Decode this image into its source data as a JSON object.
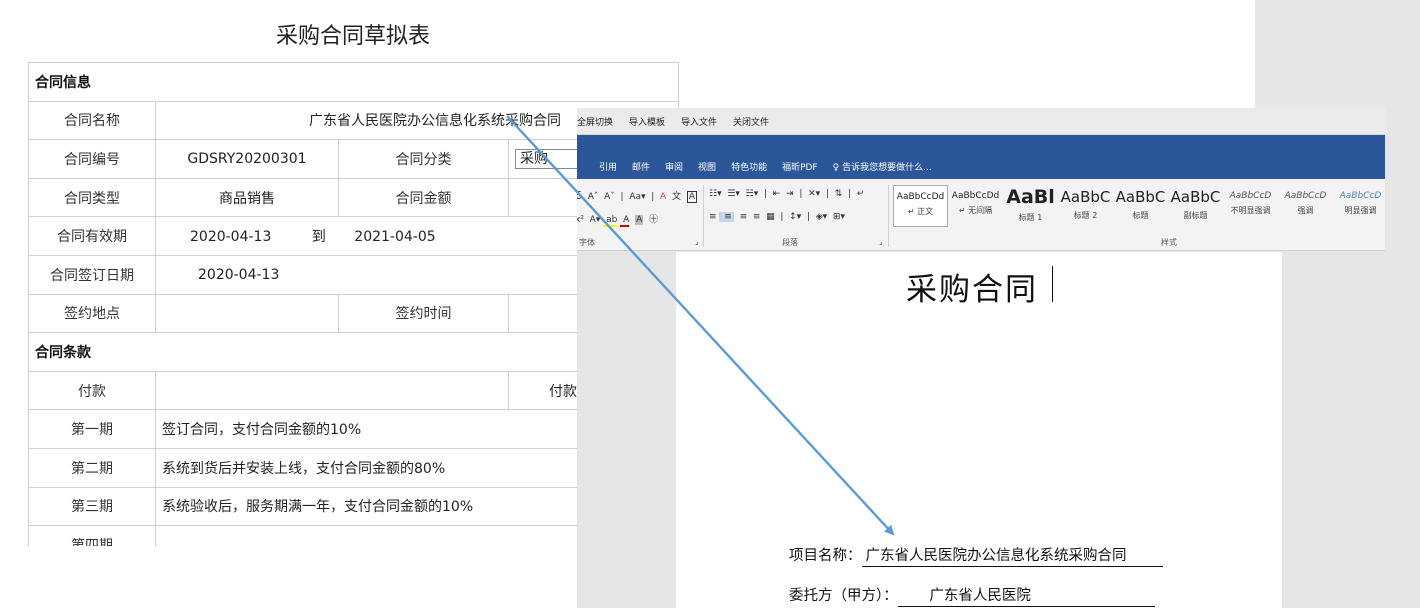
{
  "form": {
    "title": "采购合同草拟表",
    "section_info": "合同信息",
    "name_label": "合同名称",
    "name_value": "广东省人民医院办公信息化系统采购合同",
    "code_label": "合同编号",
    "code_value": "GDSRY20200301",
    "category_label": "合同分类",
    "category_value": "采购",
    "type_label": "合同类型",
    "type_value": "商品销售",
    "amount_label": "合同金额",
    "validity_label": "合同有效期",
    "validity_from": "2020-04-13",
    "validity_to_word": "到",
    "validity_to": "2021-04-05",
    "sign_date_label": "合同签订日期",
    "sign_date_value": "2020-04-13",
    "sign_place_label": "签约地点",
    "sign_time_label": "签约时间",
    "section_terms": "合同条款",
    "payment_label": "付款",
    "payment_col2": "付款",
    "terms": [
      {
        "period": "第一期",
        "text": "签订合同，支付合同金额的10%"
      },
      {
        "period": "第二期",
        "text": "系统到货后并安装上线，支付合同金额的80%"
      },
      {
        "period": "第三期",
        "text": "系统验收后，服务期满一年，支付合同金额的10%"
      },
      {
        "period": "第四期",
        "text": ""
      }
    ]
  },
  "word": {
    "quickbar": [
      "全屏切换",
      "导入模板",
      "导入文件",
      "关闭文件"
    ],
    "tabs": [
      "引用",
      "邮件",
      "审阅",
      "视图",
      "特色功能",
      "福昕PDF"
    ],
    "tell_me": "告诉我您想要做什么...",
    "group_font": "字体",
    "group_paragraph": "段落",
    "group_styles": "样式",
    "font_size_fragment": "6",
    "styles": [
      {
        "preview": "AaBbCcDd",
        "name": "正文"
      },
      {
        "preview": "AaBbCcDd",
        "name": "无间隔"
      },
      {
        "preview": "AaBl",
        "name": "标题 1"
      },
      {
        "preview": "AaBbC",
        "name": "标题 2"
      },
      {
        "preview": "AaBbC",
        "name": "标题"
      },
      {
        "preview": "AaBbC",
        "name": "副标题"
      },
      {
        "preview": "AaBbCcD",
        "name": "不明显强调"
      },
      {
        "preview": "AaBbCcD",
        "name": "强调"
      },
      {
        "preview": "AaBbCcD",
        "name": "明显强调"
      }
    ],
    "doc_title": "采购合同",
    "project_label": "项目名称：",
    "project_value": "广东省人民医院办公信息化系统采购合同",
    "client_label": "委托方（甲方）：",
    "client_value": "广东省人民医院"
  },
  "colors": {
    "ribbon_blue": "#2b579a",
    "arrow_blue": "#5b9bd5"
  }
}
